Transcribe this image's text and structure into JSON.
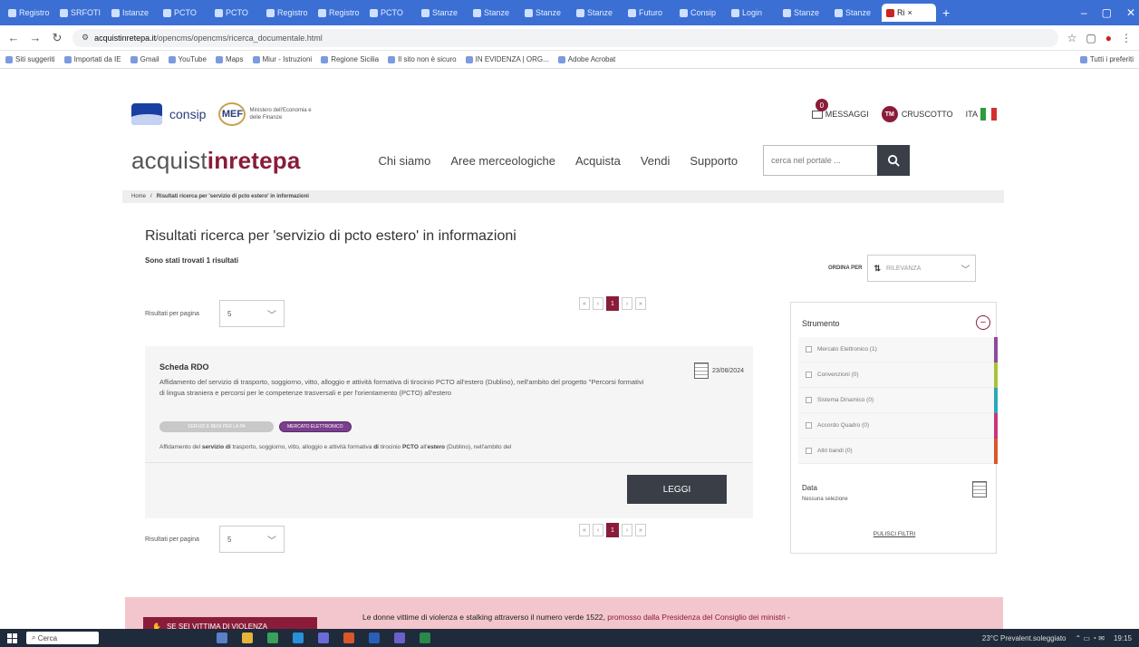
{
  "browser": {
    "tabs": [
      {
        "label": "Registro"
      },
      {
        "label": "SRFOTI"
      },
      {
        "label": "Istanze"
      },
      {
        "label": "PCTO"
      },
      {
        "label": "PCTO"
      },
      {
        "label": "Registro"
      },
      {
        "label": "Registro"
      },
      {
        "label": "PCTO"
      },
      {
        "label": "Stanze"
      },
      {
        "label": "Stanze"
      },
      {
        "label": "Stanze"
      },
      {
        "label": "Stanze"
      },
      {
        "label": "Futuro"
      },
      {
        "label": "Consip"
      },
      {
        "label": "Login"
      },
      {
        "label": "Stanze"
      },
      {
        "label": "Stanze"
      },
      {
        "label": "Ri"
      }
    ],
    "url_host": "acquistinretepa.it",
    "url_path": "/opencms/opencms/ricerca_documentale.html",
    "bookmarks": [
      "Siti suggeriti",
      "Importati da IE",
      "Gmail",
      "YouTube",
      "Maps",
      "Miur - Istruzioni",
      "Regione Sicilia",
      "Il sito non è sicuro",
      "IN EVIDENZA | ORG...",
      "Adobe Acrobat"
    ],
    "bookmarks_right": "Tutti i preferiti"
  },
  "site": {
    "consip": "consip",
    "mef": "MEF",
    "mef_sub": "Ministero dell'Economia e delle Finanze",
    "messages_count": "0",
    "messages": "MESSAGGI",
    "initials": "TM",
    "dashboard": "CRUSCOTTO",
    "lang": "ITA",
    "brand_a": "acquist",
    "brand_b": "inrete",
    "brand_c": "pa",
    "nav": [
      "Chi siamo",
      "Aree merceologiche",
      "Acquista",
      "Vendi",
      "Supporto"
    ],
    "search_placeholder": "cerca nel portale ..."
  },
  "breadcrumb": {
    "home": "Home",
    "current": "Risultati ricerca per 'servizio di pcto estero' in informazioni"
  },
  "results": {
    "title": "Risultati ricerca per 'servizio di pcto estero' in informazioni",
    "found": "Sono stati trovati 1 risultati",
    "order_label": "ORDINA PER",
    "order_value": "RILEVANZA",
    "per_page_label": "Risultati per pagina",
    "per_page_value": "5",
    "pages": [
      "«",
      "‹",
      "1",
      "›",
      "»"
    ]
  },
  "card": {
    "title": "Scheda RDO",
    "date": "23/08/2024",
    "description": "Affidamento del servizio di trasporto, soggiorno, vitto, alloggio e attività formativa di tirocinio PCTO all'estero (Dublino), nell'ambito del progetto \"Percorsi formativi di lingua straniera e percorsi per le competenze trasversali e per l'orientamento (PCTO) all'estero",
    "tag1": "SERVIZI E BENI PER LA PA",
    "tag2": "MERCATO ELETTRONICO",
    "excerpt_pre": "Affidamento del ",
    "excerpt_b1": "servizio di",
    "excerpt_mid1": " trasporto, soggiorno, vitto, alloggio e attività formativa ",
    "excerpt_b2": "di",
    "excerpt_mid2": " tirocinio ",
    "excerpt_b3": "PCTO",
    "excerpt_mid3": " all'",
    "excerpt_b4": "estero",
    "excerpt_post": " (Dublino), nell'ambito del",
    "read": "LEGGI"
  },
  "filters": {
    "title": "Strumento",
    "items": [
      {
        "label": "Mercato Elettronico (1)",
        "color": "#8e4a9c"
      },
      {
        "label": "Convenzioni (0)",
        "color": "#a8c23a"
      },
      {
        "label": "Sistema Dinamico (0)",
        "color": "#2aa8b8"
      },
      {
        "label": "Accordo Quadro (0)",
        "color": "#c8347a"
      },
      {
        "label": "Altri bandi (0)",
        "color": "#d8572a"
      }
    ],
    "date_title": "Data",
    "date_sub": "Nessuna selezione",
    "clear": "PULISCI FILTRI"
  },
  "banner": {
    "box": "SE SEI VITTIMA DI VIOLENZA",
    "text": "Le donne vittime di violenza e stalking attraverso il numero verde 1522,",
    "promo": " promosso dalla Presidenza del Consiglio dei ministri -"
  },
  "taskbar": {
    "search": "Cerca",
    "weather": "23°C Prevalent.soleggiato",
    "time": "19:15"
  },
  "colors": {
    "brand": "#8a1c3a",
    "dark_button": "#3a3f47",
    "banner": "#f2c6cc"
  }
}
